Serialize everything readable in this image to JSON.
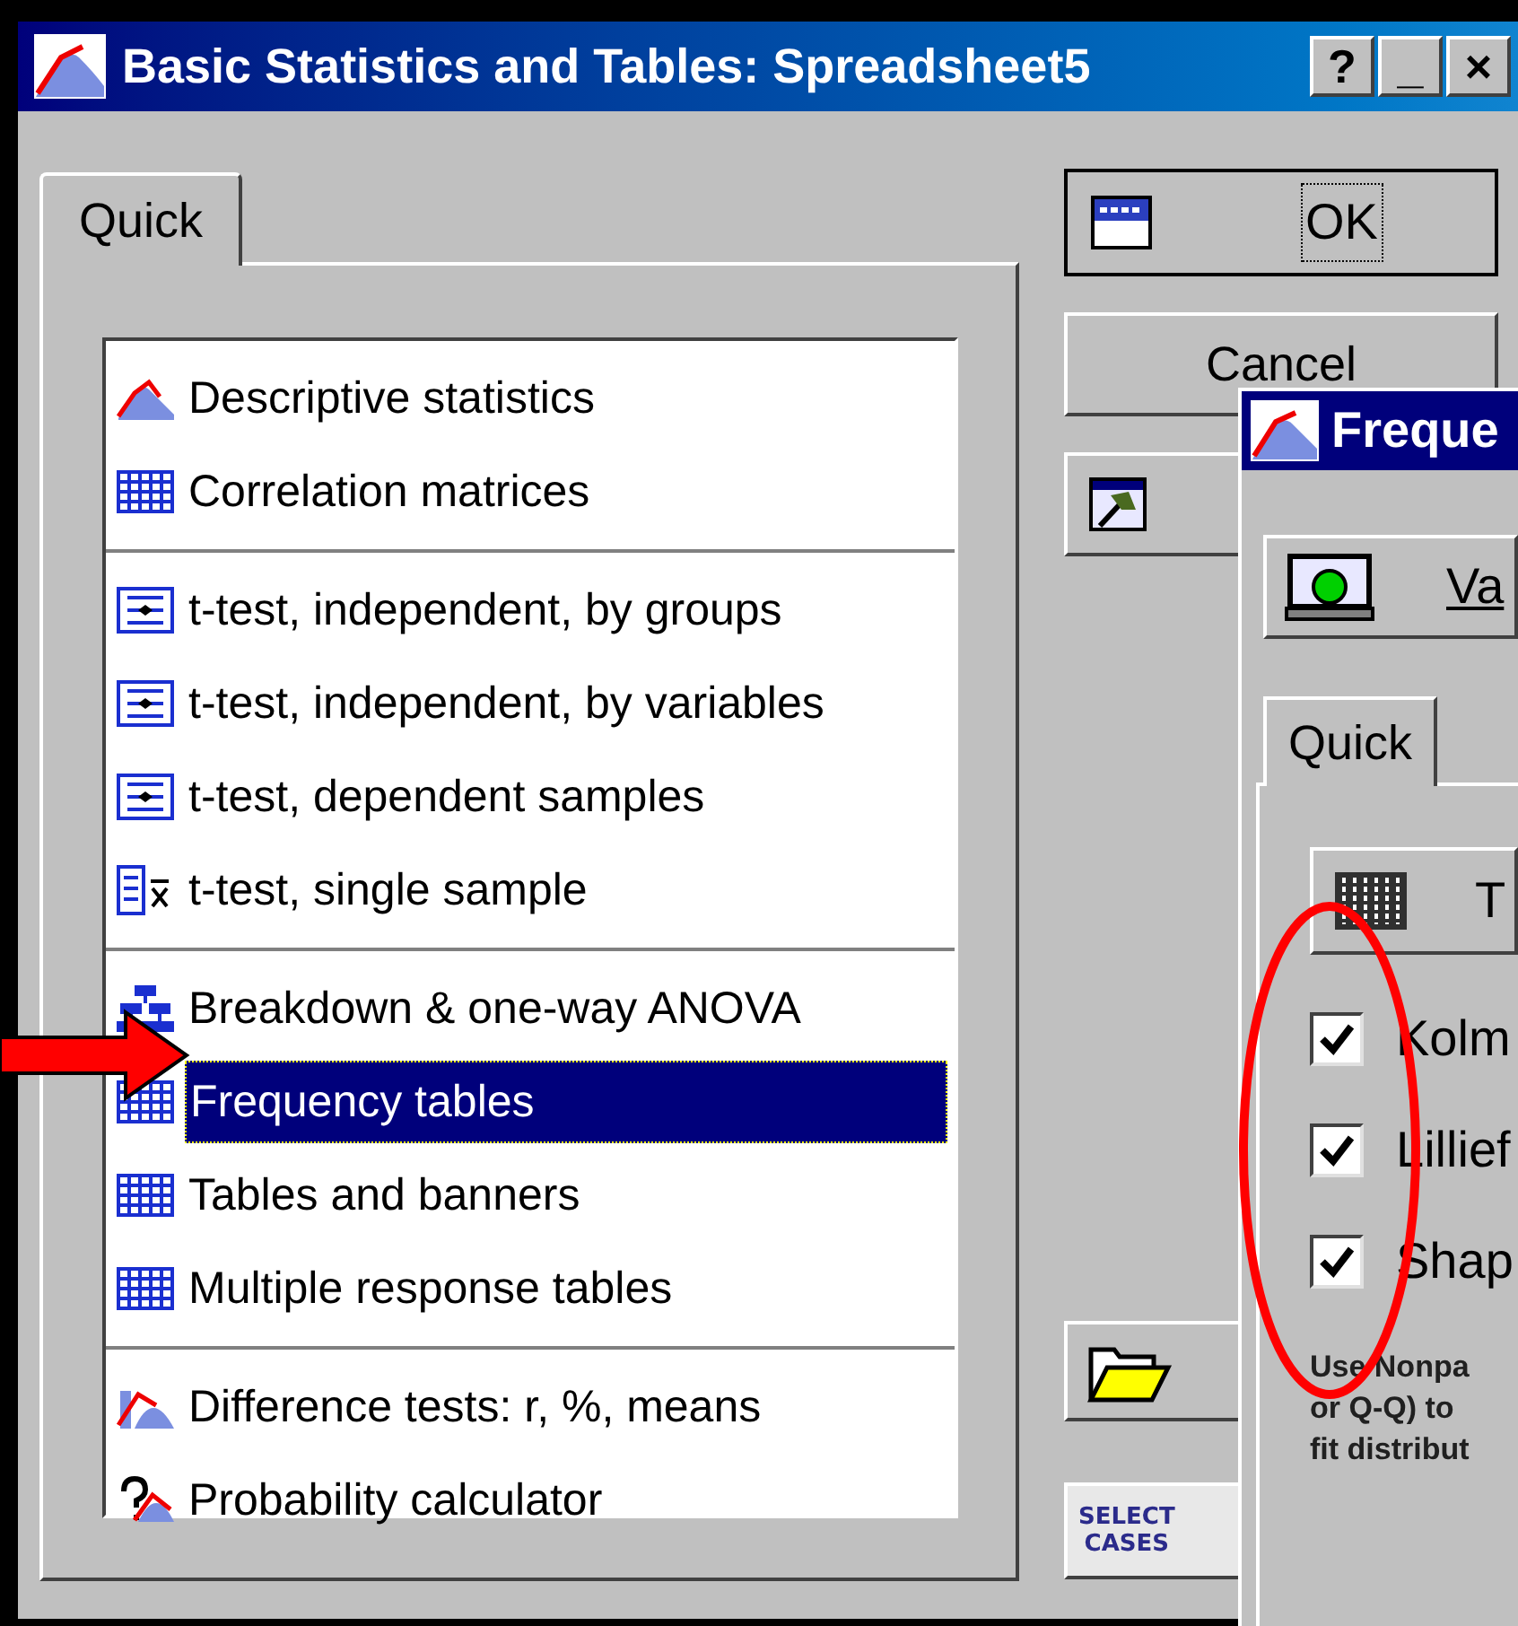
{
  "window": {
    "title": "Basic Statistics and Tables: Spreadsheet5",
    "title_buttons": [
      "?",
      "_",
      "×"
    ]
  },
  "tabs": [
    {
      "label": "Quick",
      "selected": true
    }
  ],
  "list": {
    "groups": [
      {
        "items": [
          {
            "label": "Descriptive statistics",
            "selected": false
          },
          {
            "label": "Correlation matrices",
            "selected": false
          }
        ]
      },
      {
        "items": [
          {
            "label": "t-test, independent, by groups",
            "selected": false
          },
          {
            "label": "t-test, independent, by variables",
            "selected": false
          },
          {
            "label": "t-test, dependent samples",
            "selected": false
          },
          {
            "label": "t-test, single sample",
            "selected": false
          }
        ]
      },
      {
        "items": [
          {
            "label": "Breakdown & one-way ANOVA",
            "selected": false
          },
          {
            "label": "Frequency tables",
            "selected": true
          },
          {
            "label": "Tables and banners",
            "selected": false
          },
          {
            "label": "Multiple response tables",
            "selected": false
          }
        ]
      },
      {
        "items": [
          {
            "label": "Difference tests: r, %, means",
            "selected": false
          },
          {
            "label": "Probability calculator",
            "selected": false
          }
        ]
      }
    ]
  },
  "buttons": {
    "ok": "OK",
    "cancel": "Cancel",
    "select_cases_icon": [
      "SELECT",
      "CASES"
    ]
  },
  "overlay_window": {
    "title": "Freque",
    "variables_button": "Va",
    "tabs": [
      {
        "label": "Quick",
        "selected": true
      }
    ],
    "table_button": "T",
    "checkboxes": [
      {
        "label": "Kolm",
        "checked": true
      },
      {
        "label": "Lillief",
        "checked": true
      },
      {
        "label": "Shap",
        "checked": true
      }
    ],
    "note_lines": [
      "Use Nonpa",
      "or Q-Q) to",
      "fit distribut"
    ]
  }
}
